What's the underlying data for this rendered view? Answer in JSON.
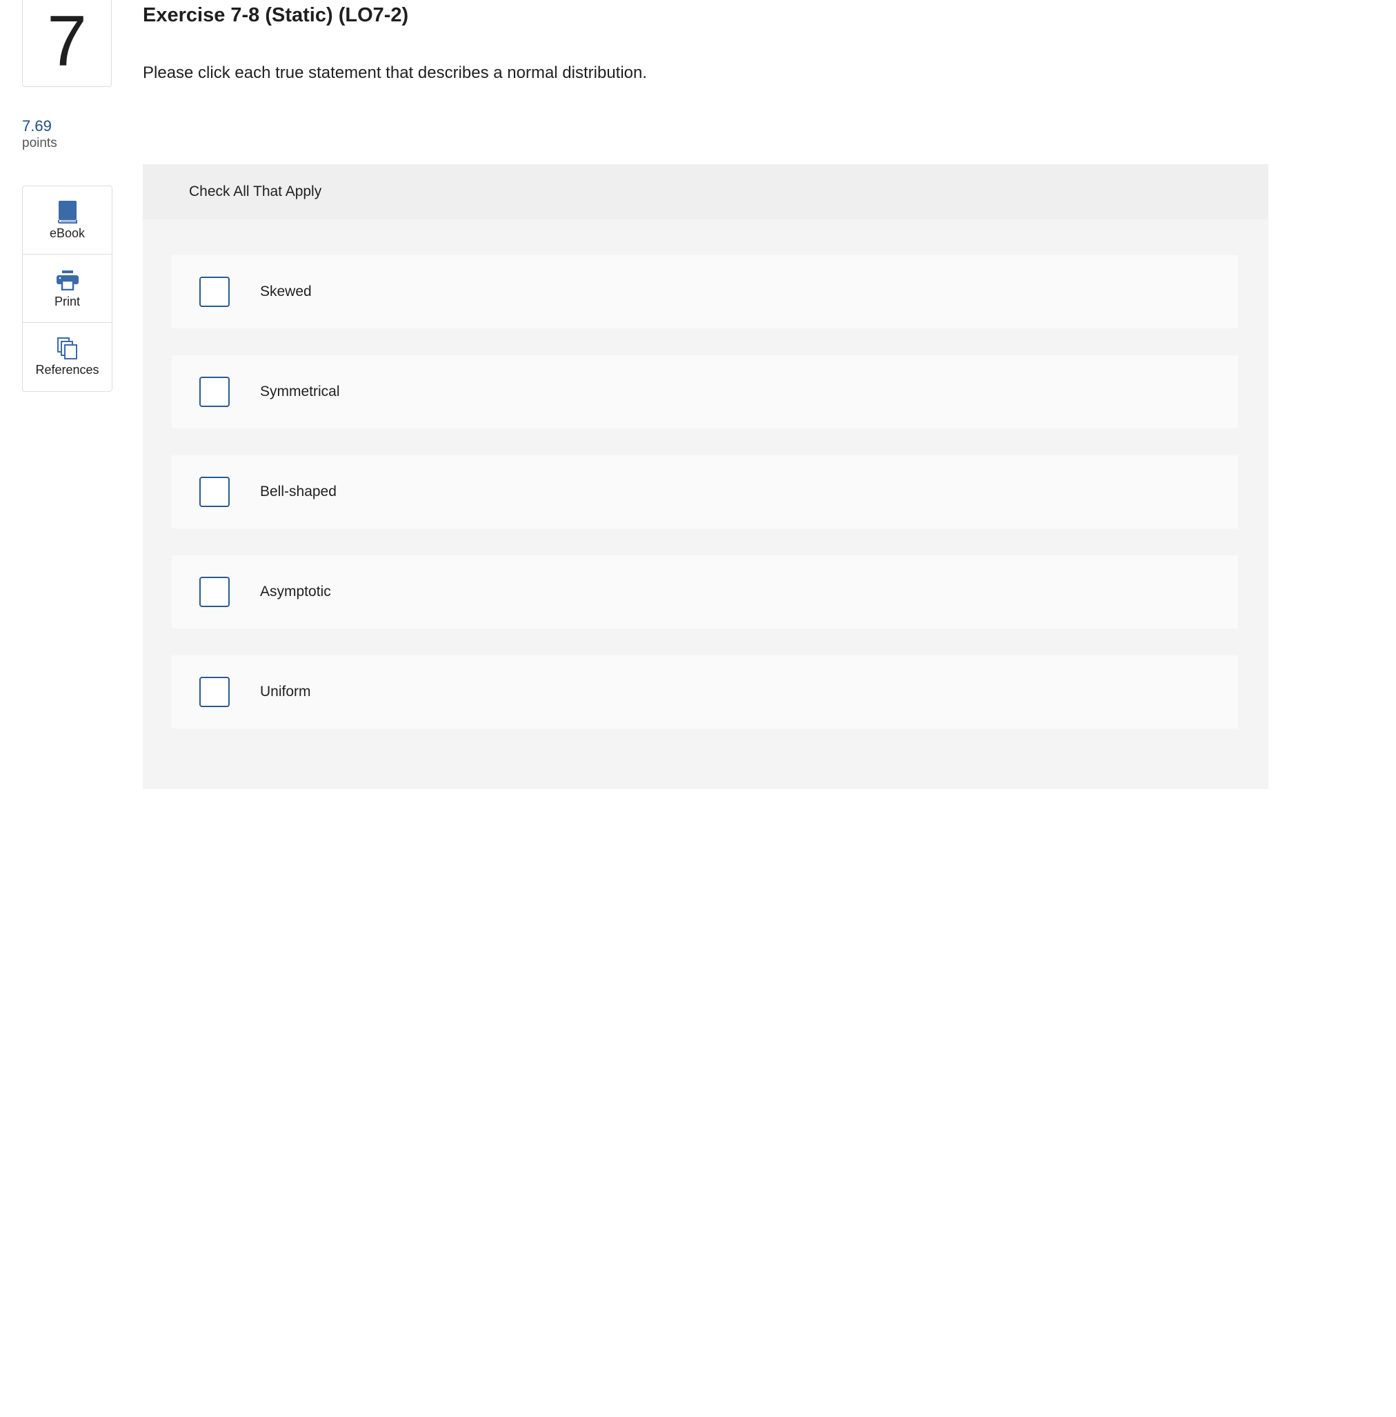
{
  "question": {
    "number": "7",
    "points_value": "7.69",
    "points_label": "points",
    "title": "Exercise 7-8 (Static) (LO7-2)",
    "prompt": "Please click each true statement that describes a normal distribution."
  },
  "tools": [
    {
      "label": "eBook",
      "icon": "book-icon"
    },
    {
      "label": "Print",
      "icon": "printer-icon"
    },
    {
      "label": "References",
      "icon": "references-icon"
    }
  ],
  "answer": {
    "header": "Check All That Apply",
    "options": [
      {
        "label": "Skewed",
        "checked": false
      },
      {
        "label": "Symmetrical",
        "checked": false
      },
      {
        "label": "Bell-shaped",
        "checked": false
      },
      {
        "label": "Asymptotic",
        "checked": false
      },
      {
        "label": "Uniform",
        "checked": false
      }
    ]
  },
  "colors": {
    "accent": "#3b6aa8",
    "checkbox_border": "#2a5a8c",
    "points": "#1d4d7e"
  }
}
